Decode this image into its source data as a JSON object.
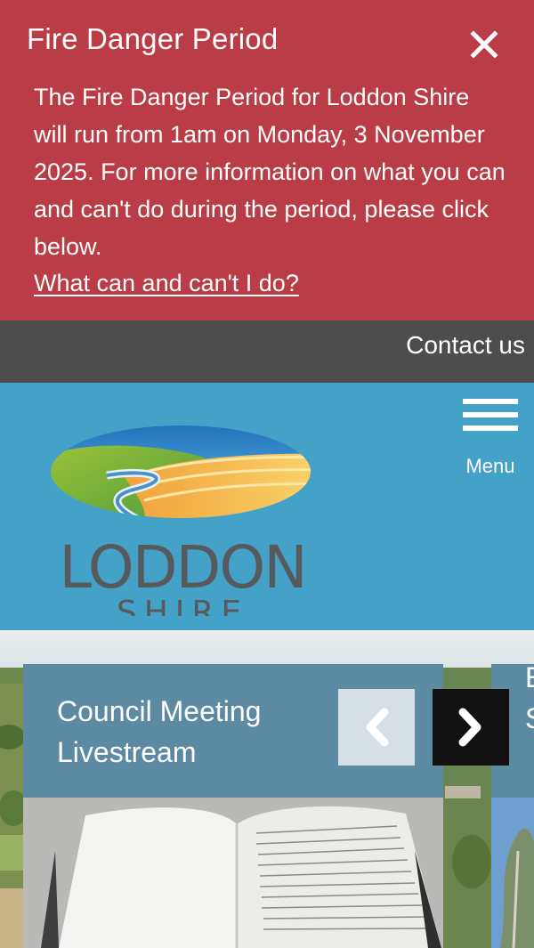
{
  "alert": {
    "title": "Fire Danger Period",
    "body": "The Fire Danger Period for Loddon Shire will run from 1am on Monday, 3 November 2025. For more information on what you can and can't do during the period, please click below.",
    "link_label": "What can and can't I do?",
    "close_icon": "close-icon",
    "background": "#b93c46"
  },
  "utility": {
    "contact_label": "Contact us",
    "background": "#4d4d4d"
  },
  "header": {
    "logo_text": "LODDON",
    "logo_subtext": "SHIRE",
    "menu_label": "Menu",
    "menu_icon": "hamburger-icon",
    "background": "#44a1c8"
  },
  "slider": {
    "current": {
      "title": "Council Meeting Livestream"
    },
    "next_peek": {
      "line1": "E",
      "line2": "S"
    },
    "prev_icon": "chevron-left-icon",
    "next_icon": "chevron-right-icon",
    "card_color": "#5c8aa2"
  }
}
